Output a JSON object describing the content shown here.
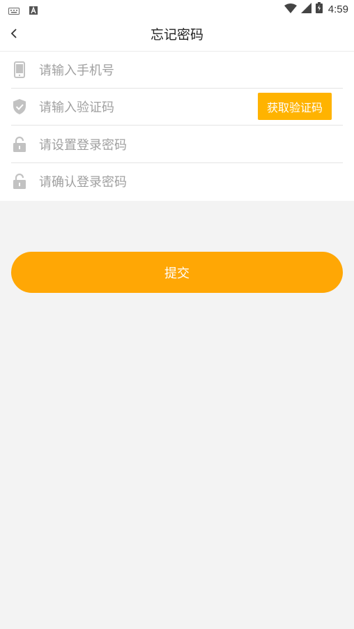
{
  "status_bar": {
    "time": "4:59",
    "left_icons": [
      "keyboard-icon",
      "a-badge-icon"
    ],
    "right_icons": [
      "wifi-icon",
      "signal-icon",
      "battery-icon"
    ]
  },
  "header": {
    "title": "忘记密码",
    "back_icon": "chevron-left-icon"
  },
  "form": {
    "phone": {
      "placeholder": "请输入手机号",
      "value": "",
      "icon": "phone-icon"
    },
    "code": {
      "placeholder": "请输入验证码",
      "value": "",
      "icon": "shield-check-icon",
      "button_label": "获取验证码"
    },
    "new_password": {
      "placeholder": "请设置登录密码",
      "value": "",
      "icon": "lock-icon"
    },
    "confirm_password": {
      "placeholder": "请确认登录密码",
      "value": "",
      "icon": "lock-icon"
    }
  },
  "submit": {
    "label": "提交"
  },
  "colors": {
    "accent": "#ffa705",
    "code_button": "#ffb300",
    "background": "#f3f3f3",
    "icon_gray": "#c2c2c2",
    "placeholder": "#a0a0a0"
  }
}
